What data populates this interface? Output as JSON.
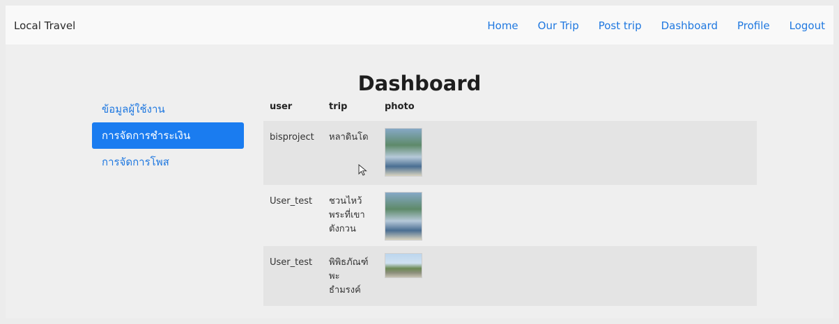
{
  "navbar": {
    "brand": "Local Travel",
    "links": [
      "Home",
      "Our Trip",
      "Post trip",
      "Dashboard",
      "Profile",
      "Logout"
    ]
  },
  "page": {
    "title": "Dashboard"
  },
  "sidebar": {
    "items": [
      {
        "label": "ข้อมูลผู้ใช้งาน",
        "active": false
      },
      {
        "label": "การจัดการชำระเงิน",
        "active": true
      },
      {
        "label": "การจัดการโพส",
        "active": false
      }
    ]
  },
  "table": {
    "headers": {
      "user": "user",
      "trip": "trip",
      "photo": "photo"
    },
    "rows": [
      {
        "user": "bisproject",
        "trip": "หลาดินโด",
        "photo": "thumbnail-tall"
      },
      {
        "user": "User_test",
        "trip": "ชวนไหว้ พระที่เขา ตังกวน",
        "photo": "thumbnail-tall"
      },
      {
        "user": "User_test",
        "trip": "พิพิธภัณฑ์ พะ ธำมรงค์",
        "photo": "thumbnail-wide"
      }
    ]
  }
}
